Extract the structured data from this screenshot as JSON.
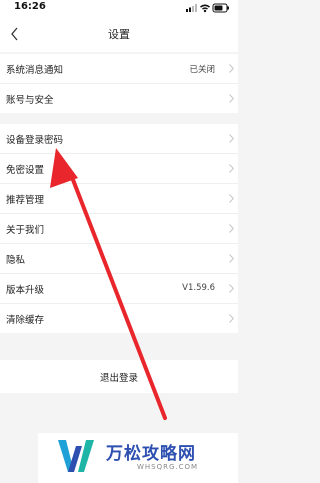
{
  "status_bar": {
    "time": "16:26"
  },
  "nav": {
    "title": "设置"
  },
  "groups": [
    {
      "items": [
        {
          "label": "系统消息通知",
          "value": "已关闭"
        },
        {
          "label": "账号与安全",
          "value": ""
        }
      ]
    },
    {
      "items": [
        {
          "label": "设备登录密码",
          "value": ""
        },
        {
          "label": "免密设置",
          "value": ""
        },
        {
          "label": "推荐管理",
          "value": ""
        },
        {
          "label": "关于我们",
          "value": ""
        },
        {
          "label": "隐私",
          "value": ""
        },
        {
          "label": "版本升级",
          "value": "V1.59.6"
        },
        {
          "label": "清除缓存",
          "value": ""
        }
      ]
    }
  ],
  "logout_label": "退出登录",
  "annotation": {
    "color": "#e8262b"
  },
  "watermark": {
    "title": "万松攻略网",
    "subtitle": "WHSQRG.COM"
  }
}
